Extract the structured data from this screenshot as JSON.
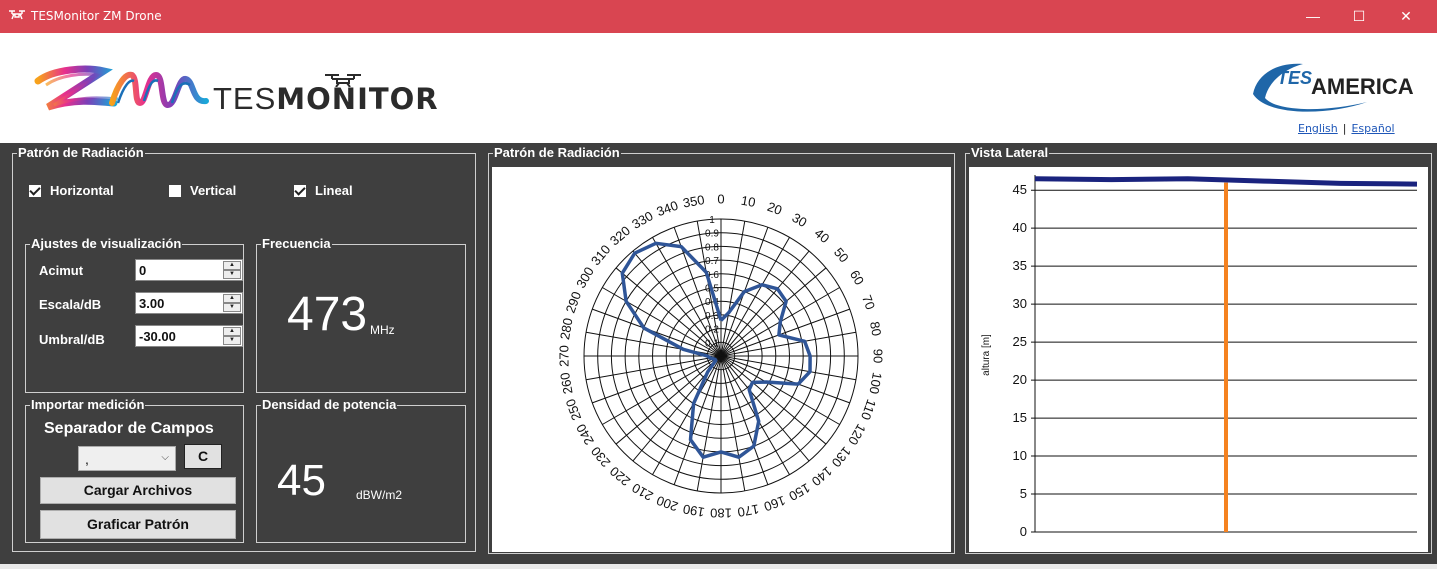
{
  "window": {
    "title": "TESMonitor ZM Drone",
    "minimize_glyph": "—",
    "maximize_glyph": "☐",
    "close_glyph": "✕"
  },
  "header": {
    "brand_light": "TES",
    "brand_bold": "MONITOR",
    "partner_logo_top": "TES",
    "partner_logo_bottom": "AMERICA",
    "lang_english": "English",
    "lang_separator": "|",
    "lang_spanish": "Español"
  },
  "left_panel": {
    "title": "Patrón de Radiación",
    "checkboxes": [
      {
        "label": "Horizontal",
        "checked": true
      },
      {
        "label": "Vertical",
        "checked": false
      },
      {
        "label": "Lineal",
        "checked": true
      }
    ],
    "display_settings": {
      "title": "Ajustes de visualización",
      "fields": [
        {
          "label": "Acimut",
          "value": "0"
        },
        {
          "label": "Escala/dB",
          "value": "3.00"
        },
        {
          "label": "Umbral/dB",
          "value": "-30.00"
        }
      ]
    },
    "frequency": {
      "title": "Frecuencia",
      "value": "473",
      "unit": "MHz"
    },
    "import": {
      "title": "Importar medición",
      "separator_label": "Separador de Campos",
      "separator_value": ",",
      "clear_button": "C",
      "load_button": "Cargar Archivos",
      "plot_button": "Graficar Patrón"
    },
    "power_density": {
      "title": "Densidad de potencia",
      "value": "45",
      "unit": "dBW/m2"
    }
  },
  "polar_panel": {
    "title": "Patrón de Radiación"
  },
  "side_panel": {
    "title": "Vista Lateral"
  },
  "chart_data": [
    {
      "type": "polar",
      "angle_labels": [
        "0",
        "10",
        "20",
        "30",
        "40",
        "50",
        "60",
        "70",
        "80",
        "90",
        "100",
        "110",
        "120",
        "130",
        "140",
        "150",
        "160",
        "170",
        "180",
        "190",
        "200",
        "210",
        "220",
        "230",
        "240",
        "250",
        "260",
        "270",
        "280",
        "290",
        "300",
        "310",
        "320",
        "330",
        "340",
        "350"
      ],
      "radial_labels": [
        "1",
        "0.9",
        "0.8",
        "0.7",
        "0.6",
        "0.5",
        "0.4",
        "0.3",
        "0.2",
        "0.1"
      ],
      "series_color": "#2f5597",
      "pattern": [
        {
          "angle": 0,
          "r": 0.26
        },
        {
          "angle": 10,
          "r": 0.32
        },
        {
          "angle": 20,
          "r": 0.5
        },
        {
          "angle": 30,
          "r": 0.6
        },
        {
          "angle": 40,
          "r": 0.64
        },
        {
          "angle": 50,
          "r": 0.62
        },
        {
          "angle": 60,
          "r": 0.5
        },
        {
          "angle": 70,
          "r": 0.45
        },
        {
          "angle": 80,
          "r": 0.62
        },
        {
          "angle": 90,
          "r": 0.65
        },
        {
          "angle": 100,
          "r": 0.66
        },
        {
          "angle": 110,
          "r": 0.6
        },
        {
          "angle": 120,
          "r": 0.38
        },
        {
          "angle": 130,
          "r": 0.3
        },
        {
          "angle": 140,
          "r": 0.32
        },
        {
          "angle": 150,
          "r": 0.55
        },
        {
          "angle": 160,
          "r": 0.7
        },
        {
          "angle": 170,
          "r": 0.75
        },
        {
          "angle": 180,
          "r": 0.7
        },
        {
          "angle": 190,
          "r": 0.75
        },
        {
          "angle": 200,
          "r": 0.65
        },
        {
          "angle": 210,
          "r": 0.4
        },
        {
          "angle": 220,
          "r": 0.15
        },
        {
          "angle": 230,
          "r": 0.05
        },
        {
          "angle": 240,
          "r": 0.05
        },
        {
          "angle": 250,
          "r": 0.06
        },
        {
          "angle": 260,
          "r": 0.08
        },
        {
          "angle": 270,
          "r": 0.1
        },
        {
          "angle": 280,
          "r": 0.28
        },
        {
          "angle": 290,
          "r": 0.6
        },
        {
          "angle": 300,
          "r": 0.8
        },
        {
          "angle": 310,
          "r": 0.94
        },
        {
          "angle": 320,
          "r": 0.98
        },
        {
          "angle": 330,
          "r": 0.95
        },
        {
          "angle": 340,
          "r": 0.85
        },
        {
          "angle": 350,
          "r": 0.62
        }
      ]
    },
    {
      "type": "line",
      "ylabel": "altura [m]",
      "ylim": [
        0,
        47
      ],
      "yticks": [
        0,
        5,
        10,
        15,
        20,
        25,
        30,
        35,
        40,
        45
      ],
      "series": [
        {
          "color": "#1a237e",
          "x": [
            0,
            0.2,
            0.4,
            0.6,
            0.8,
            1.0
          ],
          "values": [
            46.5,
            46.4,
            46.5,
            46.2,
            45.9,
            45.8
          ]
        },
        {
          "color": "#f58220",
          "x": [
            0.5,
            0.5
          ],
          "values": [
            0,
            46
          ]
        }
      ]
    }
  ]
}
